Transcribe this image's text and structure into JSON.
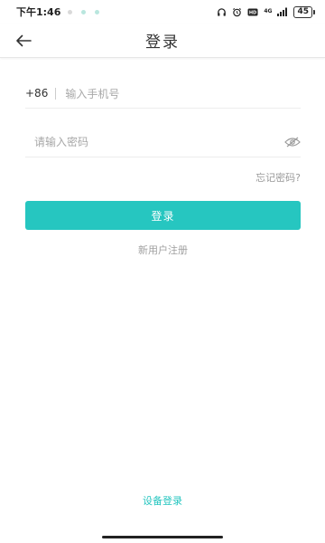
{
  "status_bar": {
    "time": "下午1:46",
    "dot_colors": [
      "#bfbfbf",
      "#8ad6c8",
      "#8ad6c8"
    ],
    "network_label": "4G",
    "battery": "45"
  },
  "header": {
    "title": "登录",
    "back_icon": "arrow-left-icon"
  },
  "form": {
    "country_code": "+86",
    "phone_placeholder": "输入手机号",
    "phone_value": "",
    "password_placeholder": "请输入密码",
    "password_value": "",
    "password_visibility_icon": "eye-off-icon",
    "forgot_label": "忘记密码?",
    "login_button_label": "登录",
    "register_label": "新用户注册"
  },
  "footer": {
    "device_login_label": "设备登录"
  },
  "colors": {
    "accent": "#26c6c0",
    "hint": "#a8a8a8",
    "divider": "#ededed"
  }
}
